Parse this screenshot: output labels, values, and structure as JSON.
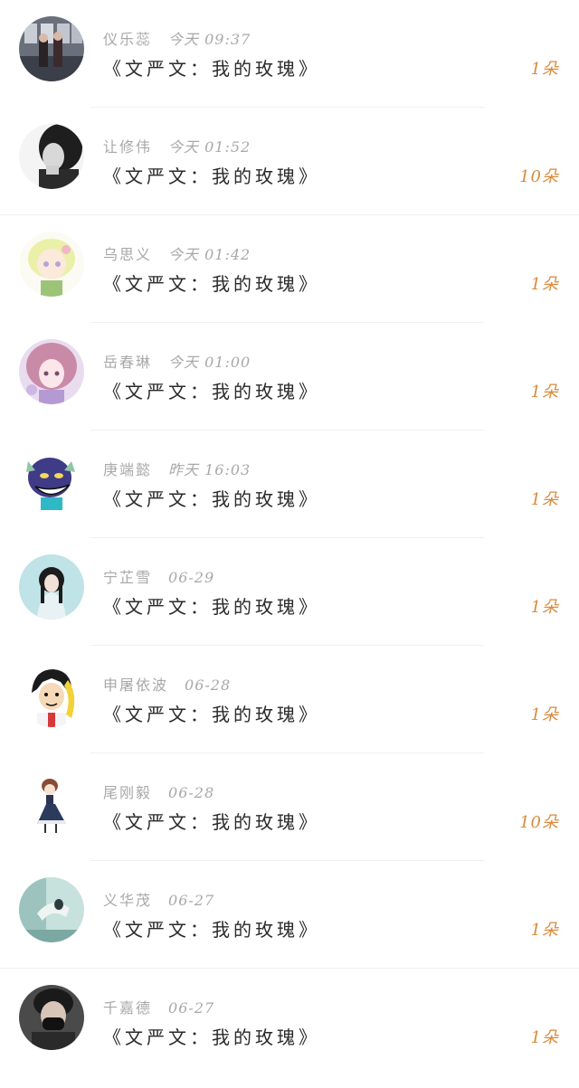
{
  "colors": {
    "name": "#a8a8a8",
    "title": "#2a2a2a",
    "count": "#d98a3c",
    "divider": "#f0f0f0"
  },
  "items": [
    {
      "name": "仪乐蕊",
      "time": "今天 09:37",
      "title": "《文严文：我的玫瑰》",
      "count": "1朵",
      "avatar_icon": "couple-photo-avatar"
    },
    {
      "name": "让修伟",
      "time": "今天 01:52",
      "title": "《文严文：我的玫瑰》",
      "count": "10朵",
      "avatar_icon": "bw-portrait-avatar"
    },
    {
      "name": "乌思义",
      "time": "今天 01:42",
      "title": "《文严文：我的玫瑰》",
      "count": "1朵",
      "avatar_icon": "anime-girl-avatar"
    },
    {
      "name": "岳春琳",
      "time": "今天 01:00",
      "title": "《文严文：我的玫瑰》",
      "count": "1朵",
      "avatar_icon": "anime-girl-pink-avatar"
    },
    {
      "name": "庚端懿",
      "time": "昨天 16:03",
      "title": "《文严文：我的玫瑰》",
      "count": "1朵",
      "avatar_icon": "cartoon-monster-avatar"
    },
    {
      "name": "宁芷雪",
      "time": "06-29",
      "title": "《文严文：我的玫瑰》",
      "count": "1朵",
      "avatar_icon": "girl-teal-avatar"
    },
    {
      "name": "申屠依波",
      "time": "06-28",
      "title": "《文严文：我的玫瑰》",
      "count": "1朵",
      "avatar_icon": "anime-boy-avatar"
    },
    {
      "name": "尾刚毅",
      "time": "06-28",
      "title": "《文严文：我的玫瑰》",
      "count": "10朵",
      "avatar_icon": "chibi-girl-avatar"
    },
    {
      "name": "义华茂",
      "time": "06-27",
      "title": "《文严文：我的玫瑰》",
      "count": "1朵",
      "avatar_icon": "mint-scene-avatar"
    },
    {
      "name": "千嘉德",
      "time": "06-27",
      "title": "《文严文：我的玫瑰》",
      "count": "1朵",
      "avatar_icon": "masked-person-avatar"
    }
  ]
}
